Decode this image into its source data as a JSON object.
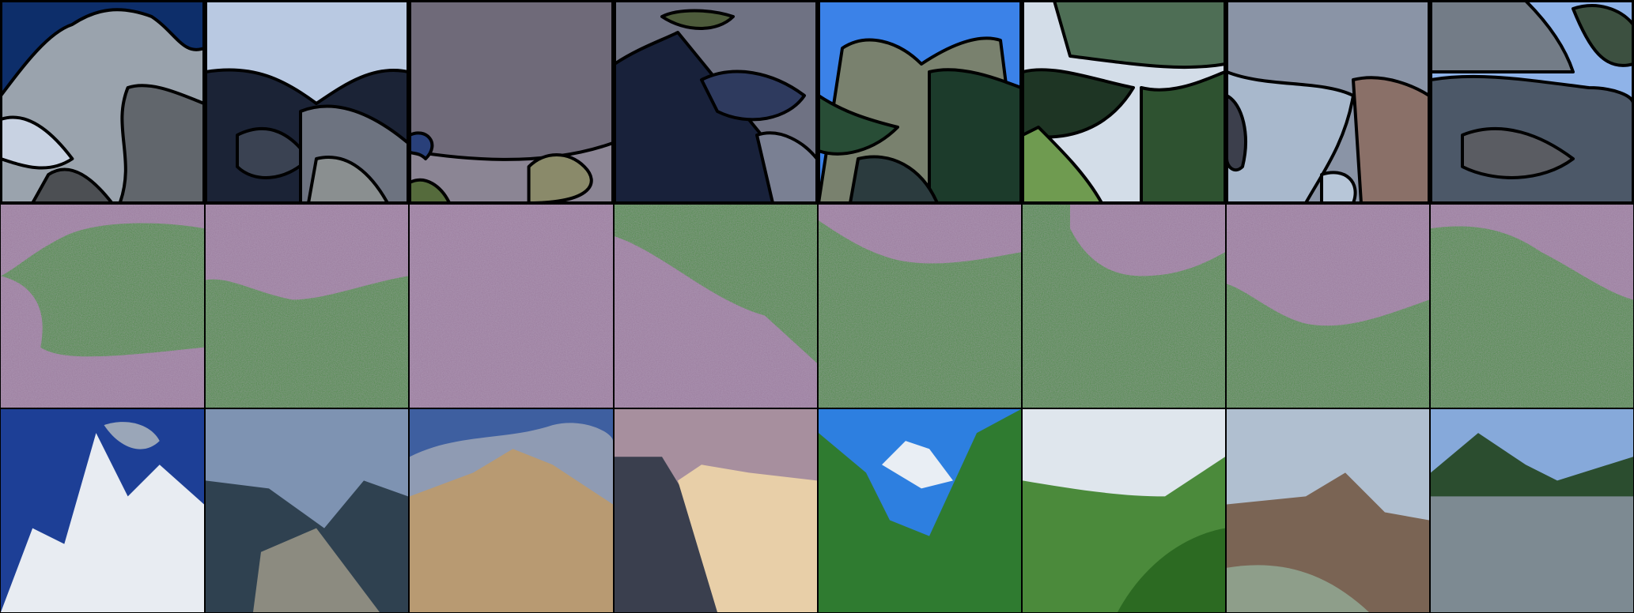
{
  "figure": {
    "rows": [
      {
        "row": "segmentation-maps",
        "count": 8
      },
      {
        "row": "generated-outputs",
        "count": 8
      },
      {
        "row": "ground-truth-photos",
        "count": 8
      }
    ]
  },
  "palette": {
    "seg": [
      [
        "#0d2e6a",
        "#9aa3ad",
        "#c8d2e2",
        "#61666c",
        "#4c4f53"
      ],
      [
        "#b9c9e2",
        "#1b2336",
        "#3a4252",
        "#6d7380",
        "#8a8f90"
      ],
      [
        "#8b8594",
        "#6f6a79",
        "#29407a",
        "#8a8a6a",
        "#556b3c"
      ],
      [
        "#6f7283",
        "#18213a",
        "#2e3a5e",
        "#7a8093",
        "#4d5b3b"
      ],
      [
        "#3b82e8",
        "#79816e",
        "#1c3b2b",
        "#284d36",
        "#2b3b3e"
      ],
      [
        "#d3dde8",
        "#4e6e55",
        "#1e3524",
        "#2e5230",
        "#6f9b50"
      ],
      [
        "#8a94a6",
        "#a8b8cc",
        "#8a7068",
        "#3c3f4c",
        "#b7c6d8"
      ],
      [
        "#8fb3e8",
        "#737c87",
        "#4c5868",
        "#5a5c62",
        "#3c5040"
      ]
    ],
    "gen": {
      "pink": "#9a7c9d",
      "green": "#4f8a4a",
      "grey": "#6c6a78"
    },
    "photo": [
      [
        "#1d3f96",
        "#e8ecf2",
        "#9aa6b8"
      ],
      [
        "#7e93b2",
        "#2f4150",
        "#8c8b80"
      ],
      [
        "#8f9bb3",
        "#b89a72",
        "#3e5fa0"
      ],
      [
        "#a78f9e",
        "#3a3f4e",
        "#e8cfa8"
      ],
      [
        "#2d7fe0",
        "#2f7b30",
        "#e9eef4"
      ],
      [
        "#dfe6ed",
        "#4b8a3b",
        "#2c6a22"
      ],
      [
        "#b0bfd0",
        "#7a6454",
        "#8e9e8a"
      ],
      [
        "#86a9da",
        "#2b4d2f",
        "#7d8a92"
      ]
    ]
  }
}
